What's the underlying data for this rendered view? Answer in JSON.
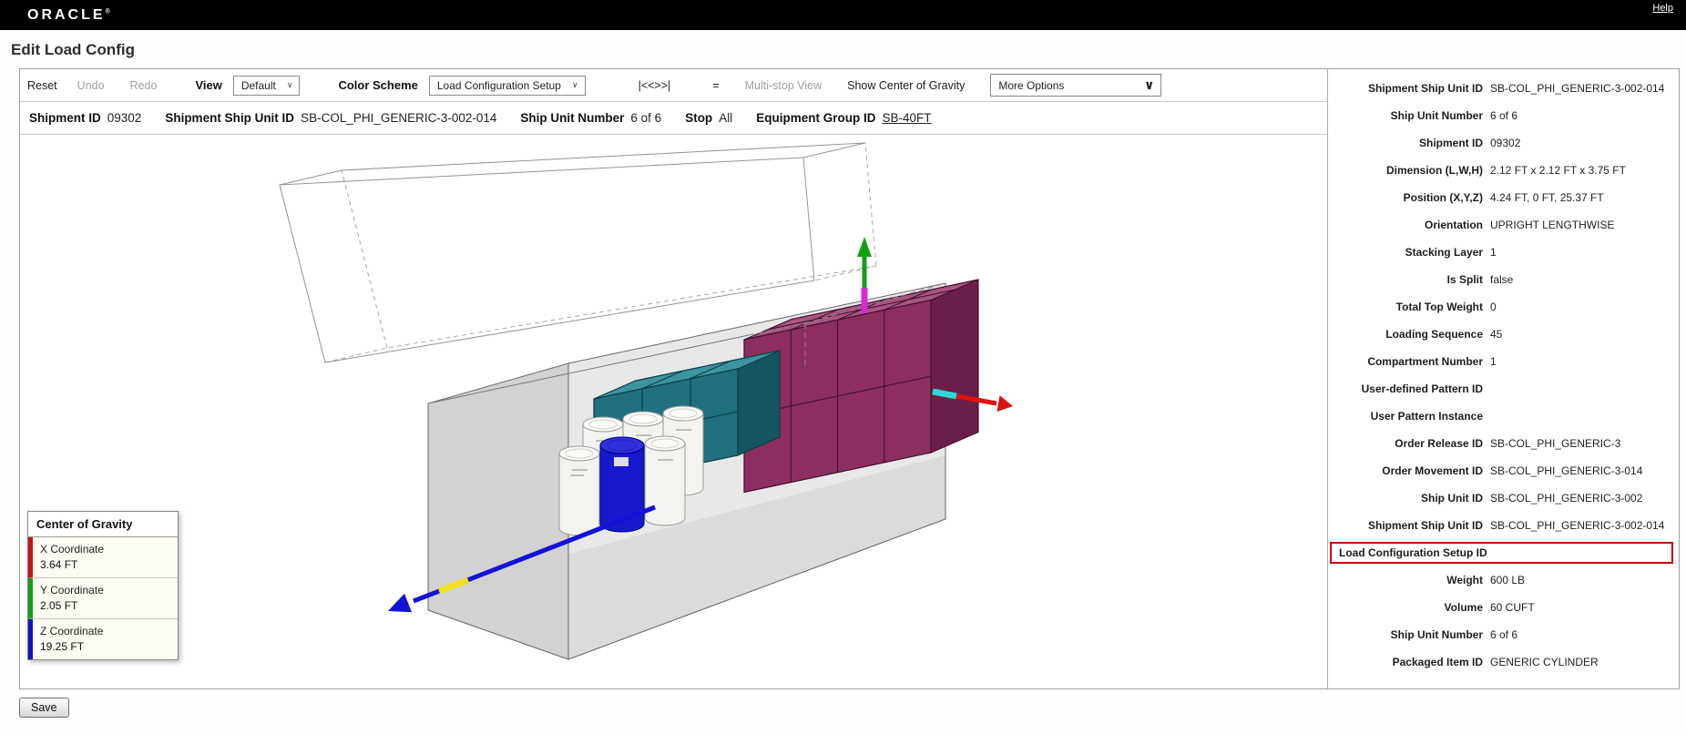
{
  "topbar": {
    "brand": "ORACLE",
    "registered": "®",
    "help_label": "Help"
  },
  "page": {
    "title": "Edit Load Config",
    "save_label": "Save"
  },
  "toolbar": {
    "reset": "Reset",
    "undo": "Undo",
    "redo": "Redo",
    "view_label": "View",
    "view_value": "Default",
    "color_scheme_label": "Color Scheme",
    "color_scheme_value": "Load Configuration Setup",
    "nav_symbols": "|<<>>|",
    "equals": "=",
    "multi_stop": "Multi-stop View",
    "show_cog": "Show Center of Gravity",
    "more_options": "More Options",
    "chevron": "∨"
  },
  "info_bar": {
    "items": [
      {
        "label": "Shipment ID",
        "value": "09302"
      },
      {
        "label": "Shipment Ship Unit ID",
        "value": "SB-COL_PHI_GENERIC-3-002-014"
      },
      {
        "label": "Ship Unit Number",
        "value": "6 of 6"
      },
      {
        "label": "Stop",
        "value": "All"
      },
      {
        "label": "Equipment Group ID",
        "value": "SB-40FT",
        "link": true
      }
    ]
  },
  "cog_panel": {
    "title": "Center of Gravity",
    "rows": [
      {
        "label": "X Coordinate",
        "value": "3.64 FT",
        "color": "#cc1111"
      },
      {
        "label": "Y Coordinate",
        "value": "2.05 FT",
        "color": "#11a011"
      },
      {
        "label": "Z Coordinate",
        "value": "19.25 FT",
        "color": "#1111cc"
      }
    ]
  },
  "details_panel": {
    "rows": [
      {
        "label": "Shipment Ship Unit ID",
        "value": "SB-COL_PHI_GENERIC-3-002-014"
      },
      {
        "label": "Ship Unit Number",
        "value": "6 of 6"
      },
      {
        "label": "Shipment ID",
        "value": "09302"
      },
      {
        "label": "Dimension (L,W,H)",
        "value": "2.12 FT x 2.12 FT x 3.75 FT"
      },
      {
        "label": "Position (X,Y,Z)",
        "value": "4.24 FT, 0 FT, 25.37 FT"
      },
      {
        "label": "Orientation",
        "value": "UPRIGHT LENGTHWISE"
      },
      {
        "label": "Stacking Layer",
        "value": "1"
      },
      {
        "label": "Is Split",
        "value": "false"
      },
      {
        "label": "Total Top Weight",
        "value": "0"
      },
      {
        "label": "Loading Sequence",
        "value": "45"
      },
      {
        "label": "Compartment Number",
        "value": "1"
      },
      {
        "label": "User-defined Pattern ID",
        "value": ""
      },
      {
        "label": "User Pattern Instance",
        "value": ""
      },
      {
        "label": "Order Release ID",
        "value": "SB-COL_PHI_GENERIC-3"
      },
      {
        "label": "Order Movement ID",
        "value": "SB-COL_PHI_GENERIC-3-014"
      },
      {
        "label": "Ship Unit ID",
        "value": "SB-COL_PHI_GENERIC-3-002"
      },
      {
        "label": "Shipment Ship Unit ID",
        "value": "SB-COL_PHI_GENERIC-3-002-014"
      },
      {
        "label": "Load Configuration Setup ID",
        "value": "",
        "highlighted": true
      },
      {
        "label": "Weight",
        "value": "600 LB"
      },
      {
        "label": "Volume",
        "value": "60 CUFT"
      },
      {
        "label": "Ship Unit Number",
        "value": "6 of 6"
      },
      {
        "label": "Packaged Item ID",
        "value": "GENERIC CYLINDER"
      }
    ]
  },
  "colors": {
    "c-highlight": "#c00000",
    "c-axis-x": "#dd1111",
    "c-axis-y": "#12a012",
    "c-axis-z": "#1212d8",
    "c-axis-yellow": "#f0e020",
    "c-axis-cyan": "#2ad8d8",
    "c-axis-magenta": "#d828d8",
    "c-maroon": "#8c2f5e",
    "c-maroon-top": "#a95580",
    "c-maroon-side": "#6b1e47",
    "c-maroon-ln": "#441030",
    "c-teal": "#20707f",
    "c-teal-top": "#3d93a0",
    "c-teal-side": "#155663",
    "c-teal-ln": "#0c3e49",
    "c-bluecyl": "#1717cb",
    "c-bluecyl-top": "#3030dd"
  }
}
